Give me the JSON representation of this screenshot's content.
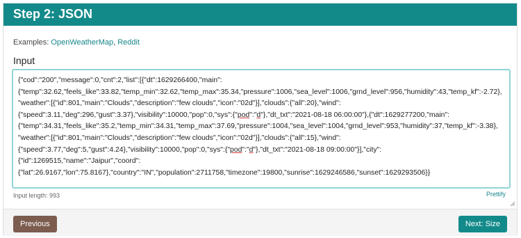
{
  "header": {
    "title": "Step 2: JSON"
  },
  "examples": {
    "label": "Examples:",
    "links": [
      "OpenWeatherMap",
      "Reddit"
    ]
  },
  "input": {
    "label": "Input",
    "lines": [
      "{\"cod\":\"200\",\"message\":0,\"cnt\":2,\"list\":[{\"dt\":1629266400,\"main\":",
      "{\"temp\":32.62,\"feels_like\":33.82,\"temp_min\":32.62,\"temp_max\":35.34,\"pressure\":1006,\"sea_level\":1006,\"grnd_level\":956,\"humidity\":43,\"temp_kf\":-2.72},",
      "\"weather\":[{\"id\":801,\"main\":\"Clouds\",\"description\":\"few clouds\",\"icon\":\"02d\"}],\"clouds\":{\"all\":20},\"wind\":",
      "{\"speed\":3.11,\"deg\":296,\"gust\":3.37},\"visibility\":10000,\"pop\":0,\"sys\":{\"",
      "pod",
      "\":\"",
      "d",
      "\"},\"dt_txt\":\"2021-08-18 06:00:00\"},{\"dt\":1629277200,\"main\":",
      "{\"temp\":34.31,\"feels_like\":35.2,\"temp_min\":34.31,\"temp_max\":37.69,\"pressure\":1004,\"sea_level\":1004,\"grnd_level\":953,\"humidity\":37,\"temp_kf\":-3.38},",
      "\"weather\":[{\"id\":801,\"main\":\"Clouds\",\"description\":\"few clouds\",\"icon\":\"02d\"}],\"clouds\":{\"all\":15},\"wind\":",
      "{\"speed\":3.77,\"deg\":5,\"gust\":4.24},\"visibility\":10000,\"pop\":0,\"sys\":{\"",
      "pod",
      "\":\"",
      "d",
      "\"},\"dt_txt\":\"2021-08-18 09:00:00\"}],\"city\":",
      "{\"id\":1269515,\"name\":\"Jaipur\",\"coord\":",
      "{\"lat\":26.9167,\"lon\":75.8167},\"country\":\"IN\",\"population\":2711758,\"timezone\":19800,\"sunrise\":1629246586,\"sunset\":1629293506}}"
    ],
    "length_text": "Input length: 993",
    "prettify_label": "Prettify"
  },
  "footer": {
    "previous_label": "Previous",
    "next_label": "Next: Size"
  },
  "colors": {
    "header_bg": "#138a8a",
    "link": "#17858c",
    "previous_bg": "#7b5c4f",
    "next_bg": "#138a8a",
    "textarea_border": "#8fd5d6"
  }
}
